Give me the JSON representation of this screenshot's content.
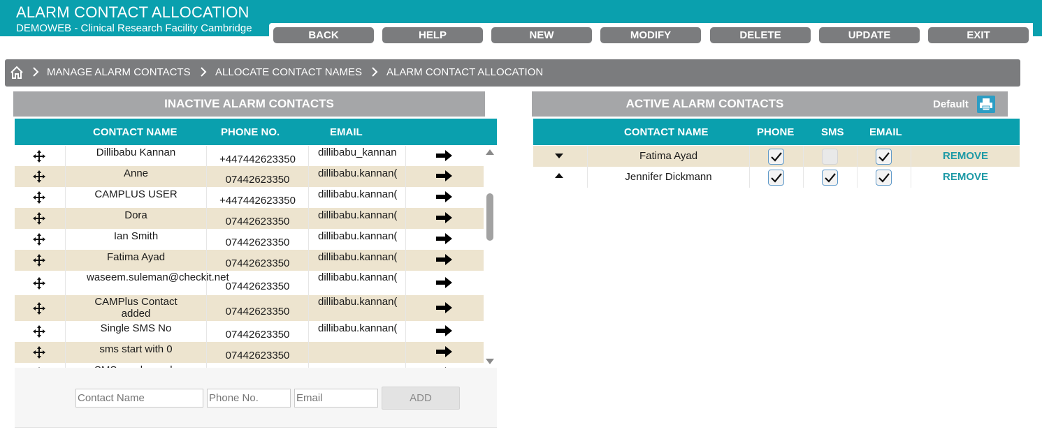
{
  "header": {
    "title": "ALARM CONTACT ALLOCATION",
    "subtitle": "DEMOWEB - Clinical Research Facility Cambridge",
    "bg_color": "#0aa0ae"
  },
  "toolbar": {
    "buttons": [
      "BACK",
      "HELP",
      "NEW",
      "MODIFY",
      "DELETE",
      "UPDATE",
      "EXIT"
    ]
  },
  "breadcrumb": {
    "home_icon": "home-icon",
    "items": [
      "MANAGE ALARM CONTACTS",
      "ALLOCATE CONTACT NAMES",
      "ALARM CONTACT ALLOCATION"
    ]
  },
  "inactive": {
    "title": "INACTIVE ALARM CONTACTS",
    "columns": [
      "CONTACT NAME",
      "PHONE NO.",
      "EMAIL"
    ],
    "rows": [
      {
        "name": "Dillibabu Kannan",
        "phone": "+447442623350",
        "email": "dillibabu_kannan"
      },
      {
        "name": "Anne",
        "phone": "07442623350",
        "email": "dillibabu.kannan("
      },
      {
        "name": "CAMPLUS USER",
        "phone": "+447442623350",
        "email": "dillibabu.kannan("
      },
      {
        "name": "Dora",
        "phone": "07442623350",
        "email": "dillibabu.kannan("
      },
      {
        "name": "Ian Smith",
        "phone": "07442623350",
        "email": "dillibabu.kannan("
      },
      {
        "name": "Fatima Ayad",
        "phone": "07442623350",
        "email": "dillibabu.kannan("
      },
      {
        "name": "waseem.suleman@checkit.net",
        "phone": "07442623350",
        "email": "dillibabu.kannan("
      },
      {
        "name": "CAMPlus Contact added",
        "phone": "07442623350",
        "email": "dillibabu.kannan("
      },
      {
        "name": "Single SMS No",
        "phone": "07442623350",
        "email": "dillibabu.kannan("
      },
      {
        "name": "sms start with 0",
        "phone": "07442623350",
        "email": ""
      },
      {
        "name": "SMS number only",
        "phone": "",
        "email": ""
      }
    ],
    "add_form": {
      "name_placeholder": "Contact Name",
      "phone_placeholder": "Phone No.",
      "email_placeholder": "Email",
      "add_label": "ADD"
    }
  },
  "active": {
    "title": "ACTIVE ALARM CONTACTS",
    "default_label": "Default",
    "print_icon": "printer-icon",
    "columns": [
      "CONTACT NAME",
      "PHONE",
      "SMS",
      "EMAIL"
    ],
    "rows": [
      {
        "name": "Fatima Ayad",
        "phone": true,
        "sms": false,
        "email": true,
        "action": "REMOVE",
        "sort": "down"
      },
      {
        "name": "Jennifer Dickmann",
        "phone": true,
        "sms": true,
        "email": true,
        "action": "REMOVE",
        "sort": "up"
      }
    ]
  },
  "colors": {
    "accent": "#0aa0ae",
    "gray_button": "#7b7c7e",
    "row_alt": "#ede4cf",
    "remove_link": "#1e9aa6"
  }
}
